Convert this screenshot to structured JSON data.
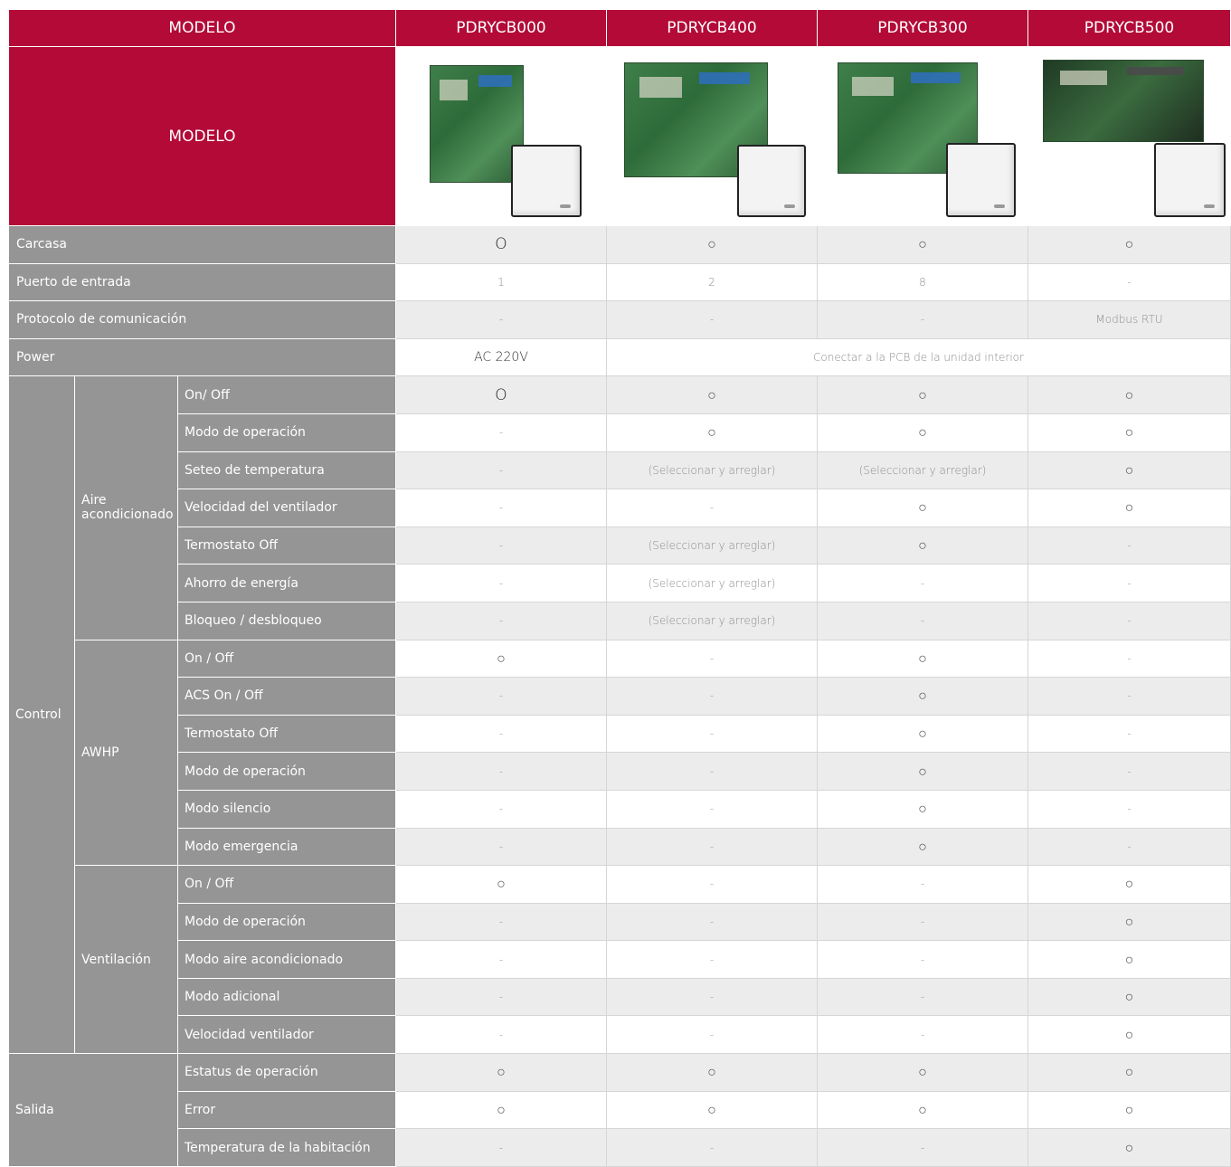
{
  "header": {
    "title": "MODELO",
    "image_row_label": "MODELO",
    "models": [
      "PDRYCB000",
      "PDRYCB400",
      "PDRYCB300",
      "PDRYCB500"
    ]
  },
  "product_images": [
    {
      "pcb": "pcb-image",
      "controller": "remote-controller-image"
    },
    {
      "pcb": "pcb-image",
      "controller": "remote-controller-image"
    },
    {
      "pcb": "pcb-image",
      "controller": "remote-controller-image"
    },
    {
      "pcb": "pcb-image",
      "controller": "remote-controller-image"
    }
  ],
  "rows_top": [
    {
      "label": "Carcasa",
      "values": [
        "O",
        "○",
        "○",
        "○"
      ]
    },
    {
      "label": "Puerto de entrada",
      "values": [
        "1",
        "2",
        "8",
        "-"
      ]
    },
    {
      "label": "Protocolo de comunicación",
      "values": [
        "-",
        "-",
        "-",
        "Modbus RTU"
      ]
    },
    {
      "label": "Power",
      "values": [
        "AC 220V",
        "Conectar a la PCB de la unidad interior"
      ]
    }
  ],
  "control": {
    "label": "Control",
    "groups": [
      {
        "label": "Aire acondicionado",
        "rows": [
          {
            "label": "On/ Off",
            "values": [
              "O",
              "○",
              "○",
              "○"
            ]
          },
          {
            "label": "Modo de operación",
            "values": [
              "-",
              "○",
              "○",
              "○"
            ]
          },
          {
            "label": "Seteo de temperatura",
            "values": [
              "-",
              "(Seleccionar y arreglar)",
              "(Seleccionar y arreglar)",
              "○"
            ]
          },
          {
            "label": "Velocidad del ventilador",
            "values": [
              "-",
              "-",
              "○",
              "○"
            ]
          },
          {
            "label": "Termostato Off",
            "values": [
              "-",
              "(Seleccionar y arreglar)",
              "○",
              "-"
            ]
          },
          {
            "label": "Ahorro de energía",
            "values": [
              "-",
              "(Seleccionar y arreglar)",
              "-",
              "-"
            ]
          },
          {
            "label": "Bloqueo / desbloqueo",
            "values": [
              "-",
              "(Seleccionar y arreglar)",
              "-",
              "-"
            ]
          }
        ]
      },
      {
        "label": "AWHP",
        "rows": [
          {
            "label": "On / Off",
            "values": [
              "○",
              "-",
              "○",
              "-"
            ]
          },
          {
            "label": "ACS On / Off",
            "values": [
              "-",
              "-",
              "○",
              "-"
            ]
          },
          {
            "label": "Termostato Off",
            "values": [
              "-",
              "-",
              "○",
              "-"
            ]
          },
          {
            "label": "Modo de operación",
            "values": [
              "-",
              "-",
              "○",
              "-"
            ]
          },
          {
            "label": "Modo silencio",
            "values": [
              "-",
              "-",
              "○",
              "-"
            ]
          },
          {
            "label": "Modo emergencia",
            "values": [
              "-",
              "-",
              "○",
              "-"
            ]
          }
        ]
      },
      {
        "label": "Ventilación",
        "rows": [
          {
            "label": "On / Off",
            "values": [
              "○",
              "-",
              "-",
              "○"
            ]
          },
          {
            "label": "Modo de operación",
            "values": [
              "-",
              "-",
              "-",
              "○"
            ]
          },
          {
            "label": "Modo aire acondicionado",
            "values": [
              "-",
              "-",
              "-",
              "○"
            ]
          },
          {
            "label": "Modo adicional",
            "values": [
              "-",
              "-",
              "-",
              "○"
            ]
          },
          {
            "label": "Velocidad ventilador",
            "values": [
              "-",
              "-",
              "-",
              "○"
            ]
          }
        ]
      }
    ]
  },
  "salida": {
    "label": "Salida",
    "rows": [
      {
        "label": "Estatus de operación",
        "values": [
          "○",
          "○",
          "○",
          "○"
        ]
      },
      {
        "label": "Error",
        "values": [
          "○",
          "○",
          "○",
          "○"
        ]
      },
      {
        "label": "Temperatura de la habitación",
        "values": [
          "-",
          "-",
          "-",
          "○"
        ]
      }
    ]
  },
  "colors": {
    "header_red": "#b30a37",
    "label_gray": "#959595",
    "alt_row": "#ececec"
  }
}
